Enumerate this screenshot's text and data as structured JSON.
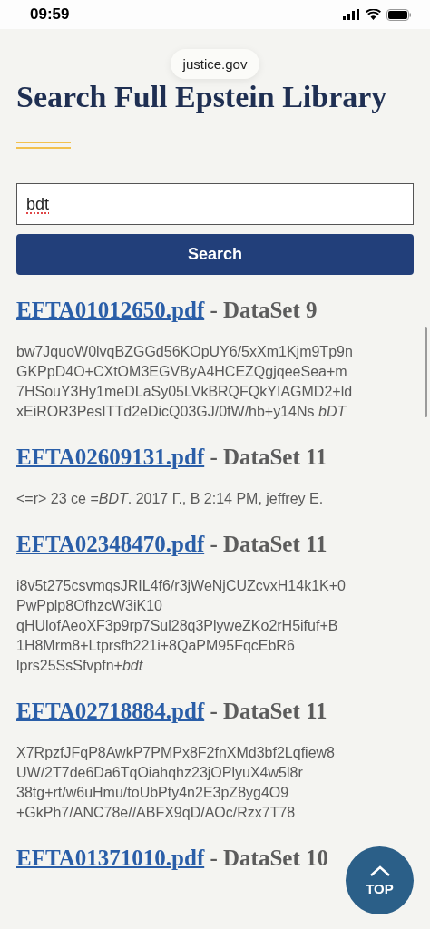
{
  "status_bar": {
    "time": "09:59"
  },
  "address_bar": {
    "url": "justice.gov"
  },
  "page": {
    "title": "Search Full Epstein Library"
  },
  "search": {
    "value": "bdt",
    "button": "Search"
  },
  "results": [
    {
      "file": "EFTA01012650.pdf",
      "dataset": "- DataSet 9",
      "lines": [
        "bw7JquoW0lvqBZGGd56KOpUY6/5xXm1Kjm9Tp9n",
        "GKPpD4O+CXtOM3EGVByA4HCEZQgjqeeSea+m",
        "7HSouY3Hy1meDLaSy05LVkBRQFQkYIAGMD2+ld",
        "xEiROR3PesITTd2eDicQ03GJ/0fW/hb+y14Ns *bDT*"
      ]
    },
    {
      "file": "EFTA02609131.pdf",
      "dataset": "- DataSet 11",
      "lines": [
        "<=r> 23 ce =*BDT*. 2017 Г., В 2:14 PM, jeffrey E."
      ]
    },
    {
      "file": "EFTA02348470.pdf",
      "dataset": "- DataSet 11",
      "lines": [
        "i8v5t275csvmqsJRIL4f6/r3jWeNjCUZcvxH14k1K+0",
        "PwPplp8OfhzcW3iK10",
        "qHUlofAeoXF3p9rp7Sul28q3PlyweZKo2rH5ifuf+B",
        "1H8Mrm8+Ltprsfh221i+8QaPM95FqcEbR6",
        "lprs25SsSfvpfn+*bdt*"
      ]
    },
    {
      "file": "EFTA02718884.pdf",
      "dataset": "- DataSet 11",
      "lines": [
        "X7RpzfJFqP8AwkP7PMPx8F2fnXMd3bf2Lqfiew8",
        "UW/2T7de6Da6TqOiahqhz23jOPlyuX4w5l8r",
        "38tg+rt/w6uHmu/toUbPty4n2E3pZ8yg4O9",
        "+GkPh7/ANC78e//ABFX9qD/AOc/Rzx7T78"
      ]
    },
    {
      "file": "EFTA01371010.pdf",
      "dataset": "- DataSet 10"
    }
  ],
  "top_button": {
    "label": "TOP"
  }
}
